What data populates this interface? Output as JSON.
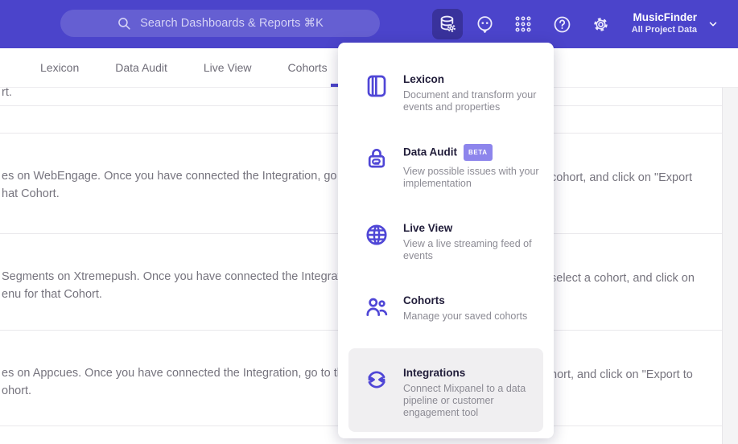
{
  "colors": {
    "header_bg": "#4b44cb",
    "accent": "#4b44cb",
    "icon_indigo": "#4f46d6",
    "badge_bg": "#8d85ec",
    "highlight_bg": "#f0eff1"
  },
  "header": {
    "search_placeholder": "Search Dashboards & Reports ⌘K",
    "project_name": "MusicFinder",
    "project_subtitle": "All Project Data"
  },
  "tabs": {
    "items": [
      {
        "label": "Lexicon"
      },
      {
        "label": "Data Audit"
      },
      {
        "label": "Live View"
      },
      {
        "label": "Cohorts"
      }
    ]
  },
  "menu": {
    "items": [
      {
        "title": "Lexicon",
        "description": "Document and transform your events and properties"
      },
      {
        "title": "Data Audit",
        "badge": "BETA",
        "description": "View possible issues with your implementation"
      },
      {
        "title": "Live View",
        "description": "View a live streaming feed of events"
      },
      {
        "title": "Cohorts",
        "description": "Manage your saved cohorts"
      },
      {
        "title": "Integrations",
        "description": "Connect Mixpanel to a data pipeline or customer engagement tool"
      }
    ]
  },
  "content": {
    "top_fragment": "rt.",
    "rows": [
      {
        "left_line1": "es on WebEngage. Once you have connected the Integration, go to the",
        "right_line1": "cohort, and click on \"Export",
        "left_line2": "hat Cohort."
      },
      {
        "left_line1": "Segments on Xtremepush. Once you have connected the Integration,",
        "right_line1": "select a cohort, and click on",
        "left_line2": "enu for that Cohort."
      },
      {
        "left_line1": "es on Appcues. Once you have connected the Integration, go to the M",
        "right_line1": "hort, and click on \"Export to",
        "left_line2": "ohort."
      }
    ]
  }
}
